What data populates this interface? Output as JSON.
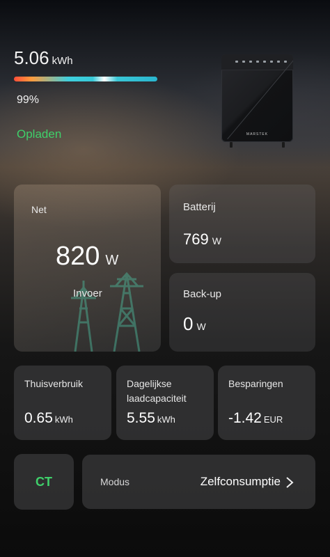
{
  "battery": {
    "energy_value": "5.06",
    "energy_unit": "kWh",
    "charge_percent_label": "99%",
    "charge_level": 0.99,
    "status": "Opladen",
    "brand": "MARSTEK"
  },
  "net": {
    "title": "Net",
    "value": "820",
    "unit": "W",
    "direction": "Invoer"
  },
  "batterij": {
    "title": "Batterij",
    "value": "769",
    "unit": "W"
  },
  "backup": {
    "title": "Back-up",
    "value": "0",
    "unit": "W"
  },
  "stats": [
    {
      "title": "Thuisverbruik",
      "value": "0.65",
      "unit": "kWh"
    },
    {
      "title": "Dagelijkse laadcapaciteit",
      "value": "5.55",
      "unit": "kWh"
    },
    {
      "title": "Besparingen",
      "value": "-1.42",
      "unit": "EUR"
    }
  ],
  "ct": {
    "label": "CT"
  },
  "mode": {
    "label": "Modus",
    "value": "Zelfconsumptie"
  },
  "colors": {
    "status_green": "#3fd06a",
    "accent_cyan": "#37c9d8",
    "accent_red": "#ff4e39"
  }
}
